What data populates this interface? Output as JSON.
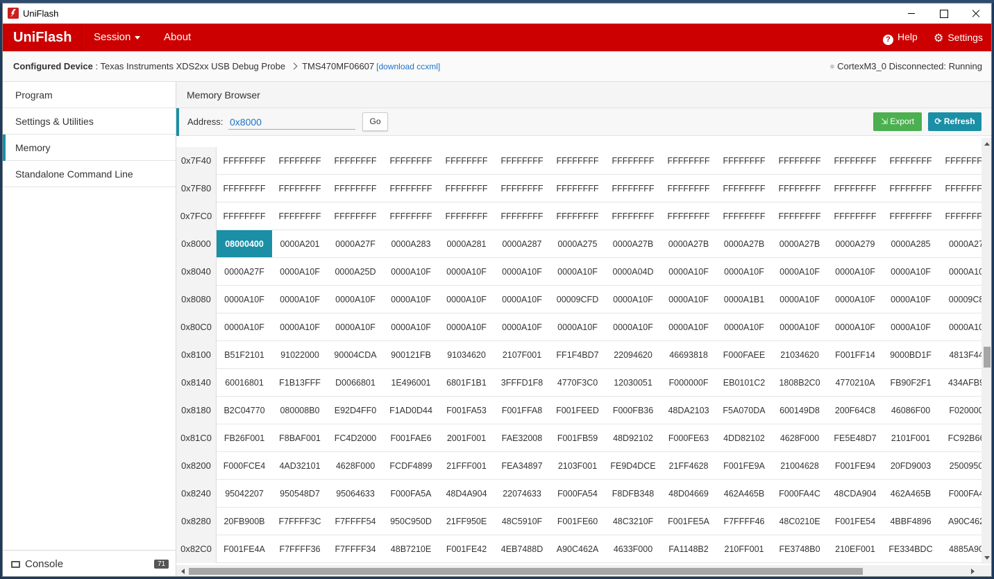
{
  "window": {
    "title": "UniFlash"
  },
  "nav": {
    "brand": "UniFlash",
    "session": "Session",
    "about": "About",
    "help": "Help",
    "settings": "Settings"
  },
  "device": {
    "configured_label": "Configured Device",
    "probe": "Texas Instruments XDS2xx USB Debug Probe",
    "target": "TMS470MF06607",
    "download_link": "[download ccxml]",
    "core_status": "CortexM3_0 Disconnected: Running"
  },
  "sidebar": {
    "items": [
      {
        "label": "Program"
      },
      {
        "label": "Settings & Utilities"
      },
      {
        "label": "Memory"
      },
      {
        "label": "Standalone Command Line"
      }
    ],
    "console_label": "Console",
    "console_count": "71"
  },
  "memory": {
    "title": "Memory Browser",
    "address_label": "Address:",
    "address_value": "0x8000",
    "go_label": "Go",
    "export_label": "Export",
    "refresh_label": "Refresh",
    "rows": [
      {
        "addr": "0x7F40",
        "cells": [
          "FFFFFFFF",
          "FFFFFFFF",
          "FFFFFFFF",
          "FFFFFFFF",
          "FFFFFFFF",
          "FFFFFFFF",
          "FFFFFFFF",
          "FFFFFFFF",
          "FFFFFFFF",
          "FFFFFFFF",
          "FFFFFFFF",
          "FFFFFFFF",
          "FFFFFFFF",
          "FFFFFFFF"
        ]
      },
      {
        "addr": "0x7F80",
        "cells": [
          "FFFFFFFF",
          "FFFFFFFF",
          "FFFFFFFF",
          "FFFFFFFF",
          "FFFFFFFF",
          "FFFFFFFF",
          "FFFFFFFF",
          "FFFFFFFF",
          "FFFFFFFF",
          "FFFFFFFF",
          "FFFFFFFF",
          "FFFFFFFF",
          "FFFFFFFF",
          "FFFFFFFF"
        ]
      },
      {
        "addr": "0x7FC0",
        "cells": [
          "FFFFFFFF",
          "FFFFFFFF",
          "FFFFFFFF",
          "FFFFFFFF",
          "FFFFFFFF",
          "FFFFFFFF",
          "FFFFFFFF",
          "FFFFFFFF",
          "FFFFFFFF",
          "FFFFFFFF",
          "FFFFFFFF",
          "FFFFFFFF",
          "FFFFFFFF",
          "FFFFFFFF"
        ]
      },
      {
        "addr": "0x8000",
        "cells": [
          "08000400",
          "0000A201",
          "0000A27F",
          "0000A283",
          "0000A281",
          "0000A287",
          "0000A275",
          "0000A27B",
          "0000A27B",
          "0000A27B",
          "0000A27B",
          "0000A279",
          "0000A285",
          "0000A27"
        ]
      },
      {
        "addr": "0x8040",
        "cells": [
          "0000A27F",
          "0000A10F",
          "0000A25D",
          "0000A10F",
          "0000A10F",
          "0000A10F",
          "0000A10F",
          "0000A04D",
          "0000A10F",
          "0000A10F",
          "0000A10F",
          "0000A10F",
          "0000A10F",
          "0000A10"
        ]
      },
      {
        "addr": "0x8080",
        "cells": [
          "0000A10F",
          "0000A10F",
          "0000A10F",
          "0000A10F",
          "0000A10F",
          "0000A10F",
          "00009CFD",
          "0000A10F",
          "0000A10F",
          "0000A1B1",
          "0000A10F",
          "0000A10F",
          "0000A10F",
          "00009C8"
        ]
      },
      {
        "addr": "0x80C0",
        "cells": [
          "0000A10F",
          "0000A10F",
          "0000A10F",
          "0000A10F",
          "0000A10F",
          "0000A10F",
          "0000A10F",
          "0000A10F",
          "0000A10F",
          "0000A10F",
          "0000A10F",
          "0000A10F",
          "0000A10F",
          "0000A10"
        ]
      },
      {
        "addr": "0x8100",
        "cells": [
          "B51F2101",
          "91022000",
          "90004CDA",
          "900121FB",
          "91034620",
          "2107F001",
          "FF1F4BD7",
          "22094620",
          "46693818",
          "F000FAEE",
          "21034620",
          "F001FF14",
          "9000BD1F",
          "4813F44"
        ]
      },
      {
        "addr": "0x8140",
        "cells": [
          "60016801",
          "F1B13FFF",
          "D0066801",
          "1E496001",
          "6801F1B1",
          "3FFFD1F8",
          "4770F3C0",
          "12030051",
          "F000000F",
          "EB0101C2",
          "1808B2C0",
          "4770210A",
          "FB90F2F1",
          "434AFB9"
        ]
      },
      {
        "addr": "0x8180",
        "cells": [
          "B2C04770",
          "080008B0",
          "E92D4FF0",
          "F1AD0D44",
          "F001FA53",
          "F001FFA8",
          "F001FEED",
          "F000FB36",
          "48DA2103",
          "F5A070DA",
          "600149D8",
          "200F64C8",
          "46086F00",
          "F020000"
        ]
      },
      {
        "addr": "0x81C0",
        "cells": [
          "FB26F001",
          "F8BAF001",
          "FC4D2000",
          "F001FAE6",
          "2001F001",
          "FAE32008",
          "F001FB59",
          "48D92102",
          "F000FE63",
          "4DD82102",
          "4628F000",
          "FE5E48D7",
          "2101F001",
          "FC92B66"
        ]
      },
      {
        "addr": "0x8200",
        "cells": [
          "F000FCE4",
          "4AD32101",
          "4628F000",
          "FCDF4899",
          "21FFF001",
          "FEA34897",
          "2103F001",
          "FE9D4DCE",
          "21FF4628",
          "F001FE9A",
          "21004628",
          "F001FE94",
          "20FD9003",
          "2500950"
        ]
      },
      {
        "addr": "0x8240",
        "cells": [
          "95042207",
          "950548D7",
          "95064633",
          "F000FA5A",
          "48D4A904",
          "22074633",
          "F000FA54",
          "F8DFB348",
          "48D04669",
          "462A465B",
          "F000FA4C",
          "48CDA904",
          "462A465B",
          "F000FA4"
        ]
      },
      {
        "addr": "0x8280",
        "cells": [
          "20FB900B",
          "F7FFFF3C",
          "F7FFFF54",
          "950C950D",
          "21FF950E",
          "48C5910F",
          "F001FE60",
          "48C3210F",
          "F001FE5A",
          "F7FFFF46",
          "48C0210E",
          "F001FE54",
          "4BBF4896",
          "A90C462"
        ]
      },
      {
        "addr": "0x82C0",
        "cells": [
          "F001FE4A",
          "F7FFFF36",
          "F7FFFF34",
          "48B7210E",
          "F001FE42",
          "4EB7488D",
          "A90C462A",
          "4633F000",
          "FA1148B2",
          "210FF001",
          "FE3748B0",
          "210EF001",
          "FE334BDC",
          "4885A90"
        ]
      }
    ]
  }
}
